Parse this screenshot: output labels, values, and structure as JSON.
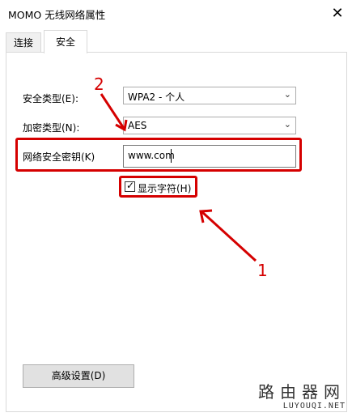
{
  "window": {
    "title": "MOMO 无线网络属性",
    "close_glyph": "✕"
  },
  "tabs": [
    {
      "label": "连接"
    },
    {
      "label": "安全"
    }
  ],
  "form": {
    "security_type": {
      "label": "安全类型(E):",
      "value": "WPA2 - 个人"
    },
    "encryption_type": {
      "label": "加密类型(N):",
      "value": "AES"
    },
    "network_key": {
      "label": "网络安全密钥(K)",
      "value": "www.com"
    },
    "show_chars": {
      "label": "显示字符(H)",
      "checked": true
    }
  },
  "advanced_button": {
    "label": "高级设置(D)"
  },
  "annotations": {
    "num1": "1",
    "num2": "2",
    "color": "#d50000"
  },
  "watermark": {
    "cn": "路由器网",
    "en": "LUYOUQI.NET"
  }
}
